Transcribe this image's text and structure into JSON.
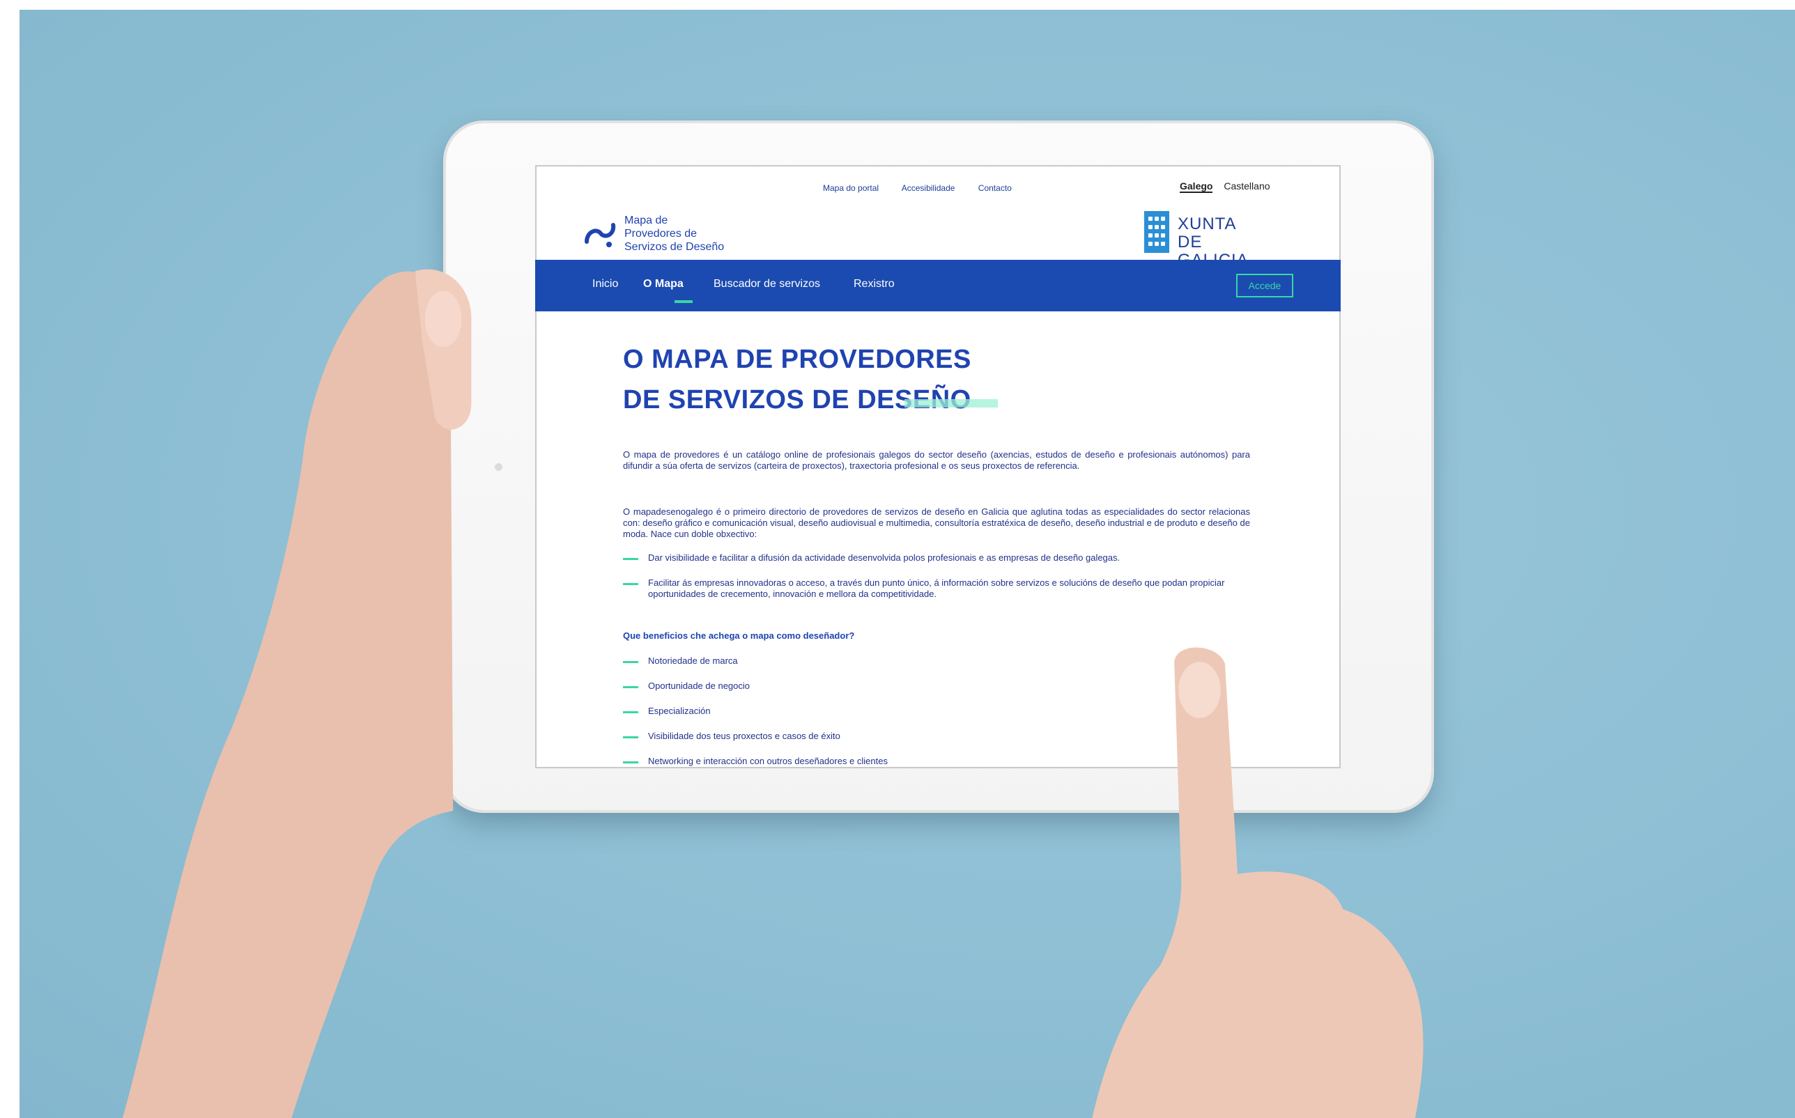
{
  "top": {
    "links": [
      "Mapa do portal",
      "Accesibilidade",
      "Contacto"
    ],
    "lang_active": "Galego",
    "lang_other": "Castellano"
  },
  "brand": {
    "line1": "Mapa de",
    "line2": "Provedores de",
    "line3": "Servizos de Deseño",
    "xunta_line1": "XUNTA",
    "xunta_line2": "DE GALICIA"
  },
  "nav": {
    "items": [
      "Inicio",
      "O Mapa",
      "Buscador de servizos",
      "Rexistro"
    ],
    "active": "O Mapa",
    "accede": "Accede"
  },
  "main": {
    "title_line1": "O MAPA DE PROVEDORES",
    "title_line2": "DE SERVIZOS DE DESEÑO",
    "para1": "O mapa de provedores é un catálogo online de profesionais galegos do sector deseño (axencias, estudos de deseño e profesionais autónomos) para difundir a súa oferta de servizos (carteira de proxectos), traxectoria profesional e os seus proxectos de referencia.",
    "para2": "O mapadesenogalego é o primeiro directorio de provedores de servizos de deseño en Galicia que aglutina todas as especialidades do sector relacionas con: deseño gráfico e comunicación visual, deseño audiovisual e multimedia, consultoría estratéxica de deseño, deseño industrial e de produto e deseño de moda. Nace cun doble obxectivo:",
    "objectives": [
      "Dar visibilidade e facilitar a difusión da actividade desenvolvida polos profesionais e as empresas de deseño galegas.",
      "Facilitar ás empresas innovadoras o acceso, a través dun punto único, á información sobre servizos e solucións de deseño que podan propiciar oportunidades de crecemento, innovación e mellora da competitividade."
    ],
    "benefits_heading": "Que beneficios che achega o mapa como deseñador?",
    "benefits": [
      "Notoriedade de marca",
      "Oportunidade de negocio",
      "Especialización",
      "Visibilidade dos teus proxectos e casos de éxito",
      "Networking e interacción con outros deseñadores e clientes"
    ]
  },
  "colors": {
    "brand_blue": "#1b4bb0",
    "accent_green": "#39d6a6",
    "background": "#8ebfd4"
  }
}
